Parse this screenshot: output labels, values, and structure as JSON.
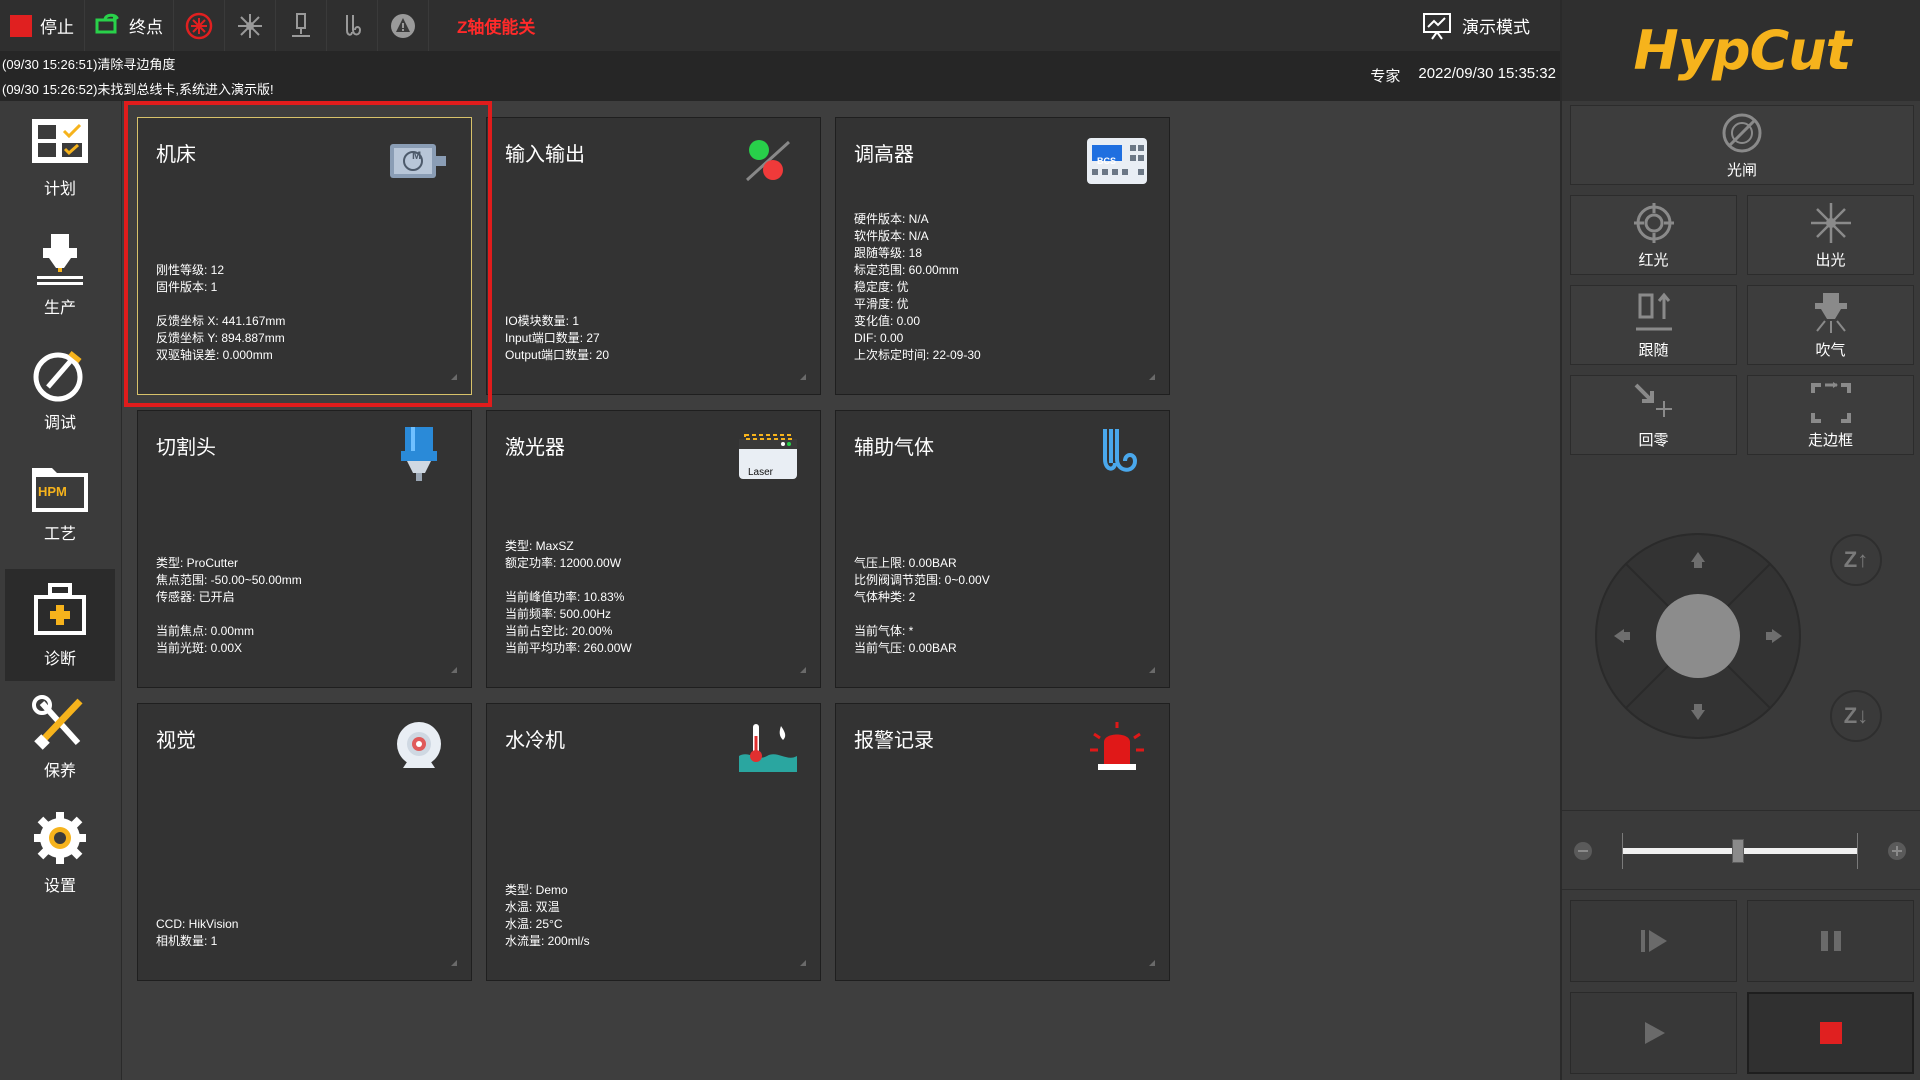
{
  "toolbar": {
    "stop_label": "停止",
    "endpoint_label": "终点",
    "z_axis_warning": "Z轴使能关",
    "demo_mode_label": "演示模式"
  },
  "logs": {
    "line1": "(09/30 15:26:51)清除寻边角度",
    "line2": "(09/30 15:26:52)未找到总线卡,系统进入演示版!"
  },
  "status": {
    "user_level": "专家",
    "datetime": "2022/09/30 15:35:32"
  },
  "sidebar": {
    "items": [
      {
        "label": "计划"
      },
      {
        "label": "生产"
      },
      {
        "label": "调试"
      },
      {
        "label": "工艺",
        "icon_text": "HPM"
      },
      {
        "label": "诊断"
      },
      {
        "label": "保养"
      },
      {
        "label": "设置"
      }
    ]
  },
  "cards": {
    "machine": {
      "title": "机床",
      "icon_text": "M",
      "lines": [
        "刚性等级: 12",
        "固件版本: 1",
        "",
        "反馈坐标 X: 441.167mm",
        "反馈坐标 Y: 894.887mm",
        "双驱轴误差: 0.000mm"
      ]
    },
    "io": {
      "title": "输入输出",
      "lines": [
        "IO模块数量: 1",
        "Input端口数量: 27",
        "Output端口数量: 20"
      ]
    },
    "height": {
      "title": "调高器",
      "icon_text": "BCS",
      "lines": [
        "硬件版本: N/A",
        "软件版本: N/A",
        "跟随等级: 18",
        "标定范围: 60.00mm",
        "稳定度: 优",
        "平滑度: 优",
        "变化值: 0.00",
        "DIF: 0.00",
        "上次标定时间: 22-09-30"
      ]
    },
    "head": {
      "title": "切割头",
      "lines": [
        "类型: ProCutter",
        "焦点范围: -50.00~50.00mm",
        "传感器: 已开启",
        "",
        "当前焦点: 0.00mm",
        "当前光斑: 0.00X"
      ]
    },
    "laser": {
      "title": "激光器",
      "icon_text": "Laser",
      "lines": [
        "类型: MaxSZ",
        "额定功率: 12000.00W",
        "",
        "当前峰值功率: 10.83%",
        "当前频率: 500.00Hz",
        "当前占空比: 20.00%",
        "当前平均功率: 260.00W"
      ]
    },
    "gas": {
      "title": "辅助气体",
      "lines": [
        "气压上限: 0.00BAR",
        "比例阀调节范围: 0~0.00V",
        "气体种类: 2",
        "",
        "当前气体: *",
        "当前气压: 0.00BAR"
      ]
    },
    "vision": {
      "title": "视觉",
      "lines": [
        "CCD: HikVision",
        "相机数量: 1"
      ]
    },
    "chiller": {
      "title": "水冷机",
      "lines": [
        "类型: Demo",
        "水温: 双温",
        "水温: 25°C",
        "水流量: 200ml/s"
      ]
    },
    "alarm": {
      "title": "报警记录",
      "lines": []
    }
  },
  "right_panel": {
    "logo": "HypCut",
    "shutter_label": "光闸",
    "red_light_label": "红光",
    "emit_light_label": "出光",
    "follow_label": "跟随",
    "blow_label": "吹气",
    "home_label": "回零",
    "frame_label": "走边框",
    "z_up_label": "Z↑",
    "z_down_label": "Z↓",
    "speed_slider_fraction": 0.49
  },
  "colors": {
    "stop_red": "#e02020",
    "warning_red": "#ff2a2a",
    "logo_orange": "#f6b31c",
    "selection_red": "#e01c1c",
    "selected_card_border": "#d7c26a"
  }
}
